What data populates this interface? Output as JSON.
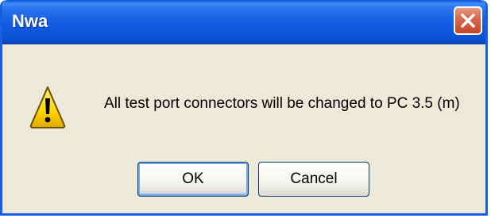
{
  "window": {
    "title": "Nwa",
    "close_icon": "close-x-icon"
  },
  "dialog": {
    "icon": "warning-icon",
    "message": "All test port connectors will be changed to PC 3.5 (m)",
    "ok_label": "OK",
    "cancel_label": "Cancel"
  },
  "colors": {
    "titlebar": "#1660e8",
    "close_button": "#d8694b",
    "dialog_background": "#ece9d8",
    "warning_fill": "#ffd400",
    "button_border": "#003c74"
  }
}
